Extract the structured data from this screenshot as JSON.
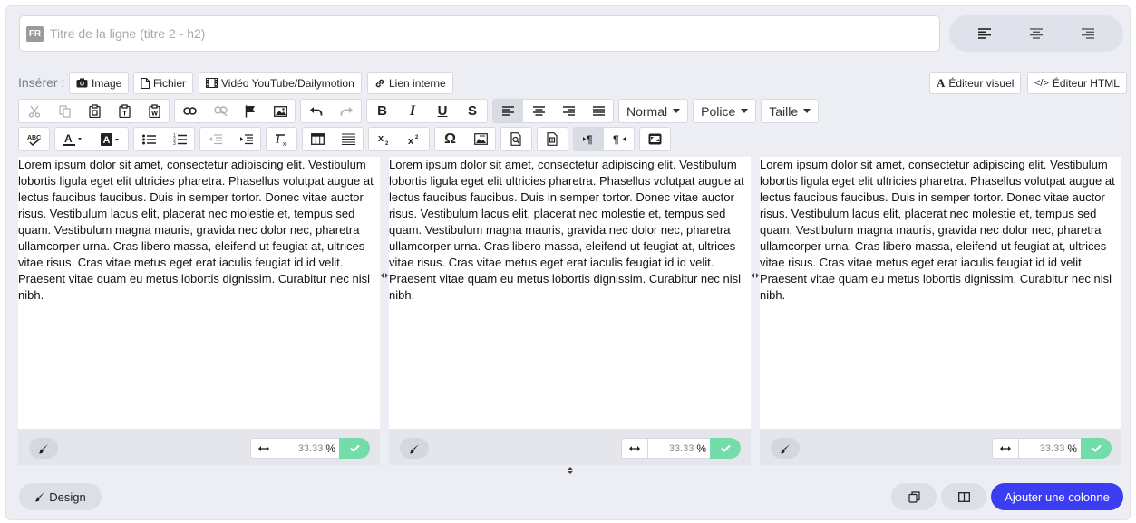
{
  "title_field": {
    "lang": "FR",
    "placeholder": "Titre de la ligne (titre 2 - h2)"
  },
  "insert": {
    "label": "Insérer :",
    "buttons": [
      "Image",
      "Fichier",
      "Vidéo YouTube/Dailymotion",
      "Lien interne"
    ]
  },
  "editors": {
    "visual": "Éditeur visuel",
    "html": "Éditeur HTML"
  },
  "dropdowns": {
    "format": "Normal",
    "font": "Police",
    "size": "Taille"
  },
  "columns": [
    {
      "text": "Lorem ipsum dolor sit amet, consectetur adipiscing elit. Vestibulum lobortis ligula eget elit ultricies pharetra. Phasellus volutpat augue at lectus faucibus faucibus. Duis in semper tortor. Donec vitae auctor risus. Vestibulum lacus elit, placerat nec molestie et, tempus sed quam. Vestibulum magna mauris, gravida nec dolor nec, pharetra ullamcorper urna. Cras libero massa, eleifend ut feugiat at, ultrices vitae risus. Cras vitae metus eget erat iaculis feugiat id id velit. Praesent vitae quam eu metus lobortis dignissim. Curabitur nec nisl nibh.",
      "width": "33.33",
      "unit": "%"
    },
    {
      "text": "Lorem ipsum dolor sit amet, consectetur adipiscing elit. Vestibulum lobortis ligula eget elit ultricies pharetra. Phasellus volutpat augue at lectus faucibus faucibus. Duis in semper tortor. Donec vitae auctor risus. Vestibulum lacus elit, placerat nec molestie et, tempus sed quam. Vestibulum magna mauris, gravida nec dolor nec, pharetra ullamcorper urna. Cras libero massa, eleifend ut feugiat at, ultrices vitae risus. Cras vitae metus eget erat iaculis feugiat id id velit. Praesent vitae quam eu metus lobortis dignissim. Curabitur nec nisl nibh.",
      "width": "33.33",
      "unit": "%"
    },
    {
      "text": "Lorem ipsum dolor sit amet, consectetur adipiscing elit. Vestibulum lobortis ligula eget elit ultricies pharetra. Phasellus volutpat augue at lectus faucibus faucibus. Duis in semper tortor. Donec vitae auctor risus. Vestibulum lacus elit, placerat nec molestie et, tempus sed quam. Vestibulum magna mauris, gravida nec dolor nec, pharetra ullamcorper urna. Cras libero massa, eleifend ut feugiat at, ultrices vitae risus. Cras vitae metus eget erat iaculis feugiat id id velit. Praesent vitae quam eu metus lobortis dignissim. Curabitur nec nisl nibh.",
      "width": "33.33",
      "unit": "%"
    }
  ],
  "footer": {
    "design": "Design",
    "add_column": "Ajouter une colonne"
  },
  "colors": {
    "accent": "#3b3df2",
    "confirm": "#73dca9",
    "panel": "#eceef3"
  }
}
